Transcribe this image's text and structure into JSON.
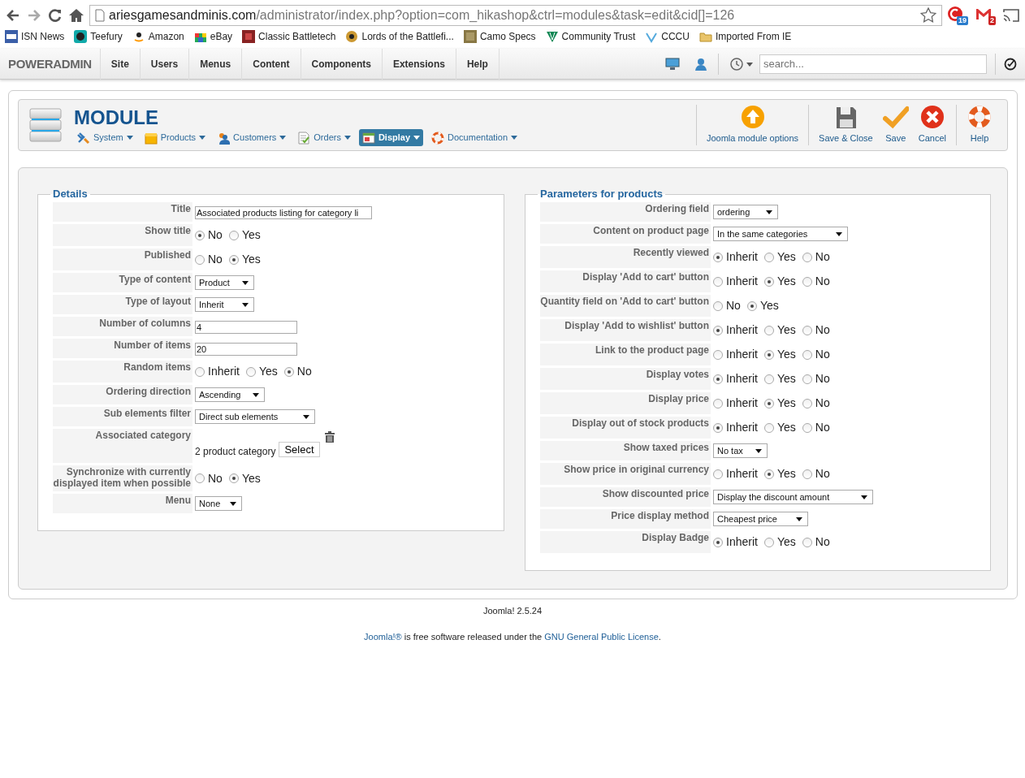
{
  "browser": {
    "url_host": "ariesgamesandminis.com",
    "url_path": "/administrator/index.php?option=com_hikashop&ctrl=modules&task=edit&cid[]=126",
    "extension_badges": [
      "19",
      "2"
    ]
  },
  "bookmarks": [
    "ISN News",
    "Teefury",
    "Amazon",
    "eBay",
    "Classic Battletech",
    "Lords of the Battlefi...",
    "Camo Specs",
    "Community Trust",
    "CCCU",
    "Imported From IE"
  ],
  "admin_nav": {
    "brand": "POWERADMIN",
    "items": [
      "Site",
      "Users",
      "Menus",
      "Content",
      "Components",
      "Extensions",
      "Help"
    ],
    "search_placeholder": "search..."
  },
  "toolbar": {
    "title": "MODULE",
    "menus": [
      {
        "label": "System",
        "selected": false
      },
      {
        "label": "Products",
        "selected": false
      },
      {
        "label": "Customers",
        "selected": false
      },
      {
        "label": "Orders",
        "selected": false
      },
      {
        "label": "Display",
        "selected": true
      },
      {
        "label": "Documentation",
        "selected": false
      }
    ],
    "action_groups": [
      {
        "actions": [
          {
            "label": "Joomla module options",
            "kind": "options"
          }
        ]
      },
      {
        "actions": [
          {
            "label": "Save & Close",
            "kind": "save-close"
          },
          {
            "label": "Save",
            "kind": "save"
          },
          {
            "label": "Cancel",
            "kind": "cancel"
          }
        ]
      },
      {
        "actions": [
          {
            "label": "Help",
            "kind": "help"
          }
        ]
      }
    ]
  },
  "details": {
    "legend": "Details",
    "rows": [
      {
        "label": "Title",
        "kind": "text",
        "value": "Associated products listing for category li"
      },
      {
        "label": "Show title",
        "kind": "radio",
        "options": [
          {
            "label": "No",
            "selected": true
          },
          {
            "label": "Yes",
            "selected": false
          }
        ]
      },
      {
        "label": "Published",
        "kind": "radio",
        "options": [
          {
            "label": "No",
            "selected": false
          },
          {
            "label": "Yes",
            "selected": true
          }
        ]
      },
      {
        "label": "Type of content",
        "kind": "select",
        "value": "Product"
      },
      {
        "label": "Type of layout",
        "kind": "select",
        "value": "Inherit"
      },
      {
        "label": "Number of columns",
        "kind": "text",
        "value": "4"
      },
      {
        "label": "Number of items",
        "kind": "text",
        "value": "20"
      },
      {
        "label": "Random items",
        "kind": "radio",
        "options": [
          {
            "label": "Inherit",
            "selected": false
          },
          {
            "label": "Yes",
            "selected": false
          },
          {
            "label": "No",
            "selected": true
          }
        ]
      },
      {
        "label": "Ordering direction",
        "kind": "select",
        "value": "Ascending"
      },
      {
        "label": "Sub elements filter",
        "kind": "select",
        "value": "Direct sub elements"
      },
      {
        "label": "Associated category",
        "kind": "category",
        "value": "2 product category",
        "button": "Select"
      },
      {
        "label": "Synchronize with currently displayed item when possible",
        "kind": "radio",
        "options": [
          {
            "label": "No",
            "selected": false
          },
          {
            "label": "Yes",
            "selected": true
          }
        ]
      },
      {
        "label": "Menu",
        "kind": "select",
        "value": "None"
      }
    ]
  },
  "params": {
    "legend": "Parameters for products",
    "rows": [
      {
        "label": "Ordering field",
        "kind": "select",
        "value": "ordering"
      },
      {
        "label": "Content on product page",
        "kind": "select",
        "value": "In the same categories"
      },
      {
        "label": "Recently viewed",
        "kind": "radio",
        "options": [
          {
            "label": "Inherit",
            "selected": true
          },
          {
            "label": "Yes",
            "selected": false
          },
          {
            "label": "No",
            "selected": false
          }
        ]
      },
      {
        "label": "Display 'Add to cart' button",
        "kind": "radio",
        "options": [
          {
            "label": "Inherit",
            "selected": false
          },
          {
            "label": "Yes",
            "selected": true
          },
          {
            "label": "No",
            "selected": false
          }
        ]
      },
      {
        "label": "Quantity field on 'Add to cart' button",
        "kind": "radio",
        "options": [
          {
            "label": "No",
            "selected": false
          },
          {
            "label": "Yes",
            "selected": true
          }
        ]
      },
      {
        "label": "Display 'Add to wishlist' button",
        "kind": "radio",
        "options": [
          {
            "label": "Inherit",
            "selected": true
          },
          {
            "label": "Yes",
            "selected": false
          },
          {
            "label": "No",
            "selected": false
          }
        ]
      },
      {
        "label": "Link to the product page",
        "kind": "radio",
        "options": [
          {
            "label": "Inherit",
            "selected": false
          },
          {
            "label": "Yes",
            "selected": true
          },
          {
            "label": "No",
            "selected": false
          }
        ]
      },
      {
        "label": "Display votes",
        "kind": "radio",
        "options": [
          {
            "label": "Inherit",
            "selected": true
          },
          {
            "label": "Yes",
            "selected": false
          },
          {
            "label": "No",
            "selected": false
          }
        ]
      },
      {
        "label": "Display price",
        "kind": "radio",
        "options": [
          {
            "label": "Inherit",
            "selected": false
          },
          {
            "label": "Yes",
            "selected": true
          },
          {
            "label": "No",
            "selected": false
          }
        ]
      },
      {
        "label": "Display out of stock products",
        "kind": "radio",
        "options": [
          {
            "label": "Inherit",
            "selected": true
          },
          {
            "label": "Yes",
            "selected": false
          },
          {
            "label": "No",
            "selected": false
          }
        ]
      },
      {
        "label": "Show taxed prices",
        "kind": "select",
        "value": "No tax"
      },
      {
        "label": "Show price in original currency",
        "kind": "radio",
        "options": [
          {
            "label": "Inherit",
            "selected": false
          },
          {
            "label": "Yes",
            "selected": true
          },
          {
            "label": "No",
            "selected": false
          }
        ]
      },
      {
        "label": "Show discounted price",
        "kind": "select",
        "value": "Display the discount amount"
      },
      {
        "label": "Price display method",
        "kind": "select",
        "value": "Cheapest price"
      },
      {
        "label": "Display Badge",
        "kind": "radio",
        "options": [
          {
            "label": "Inherit",
            "selected": true
          },
          {
            "label": "Yes",
            "selected": false
          },
          {
            "label": "No",
            "selected": false
          }
        ]
      }
    ]
  },
  "footer": {
    "version": "Joomla! 2.5.24",
    "license": [
      {
        "text": "Joomla!®",
        "link": true
      },
      {
        "text": " is free software released under the ",
        "link": false
      },
      {
        "text": "GNU General Public License",
        "link": true
      },
      {
        "text": ".",
        "link": false
      }
    ]
  }
}
